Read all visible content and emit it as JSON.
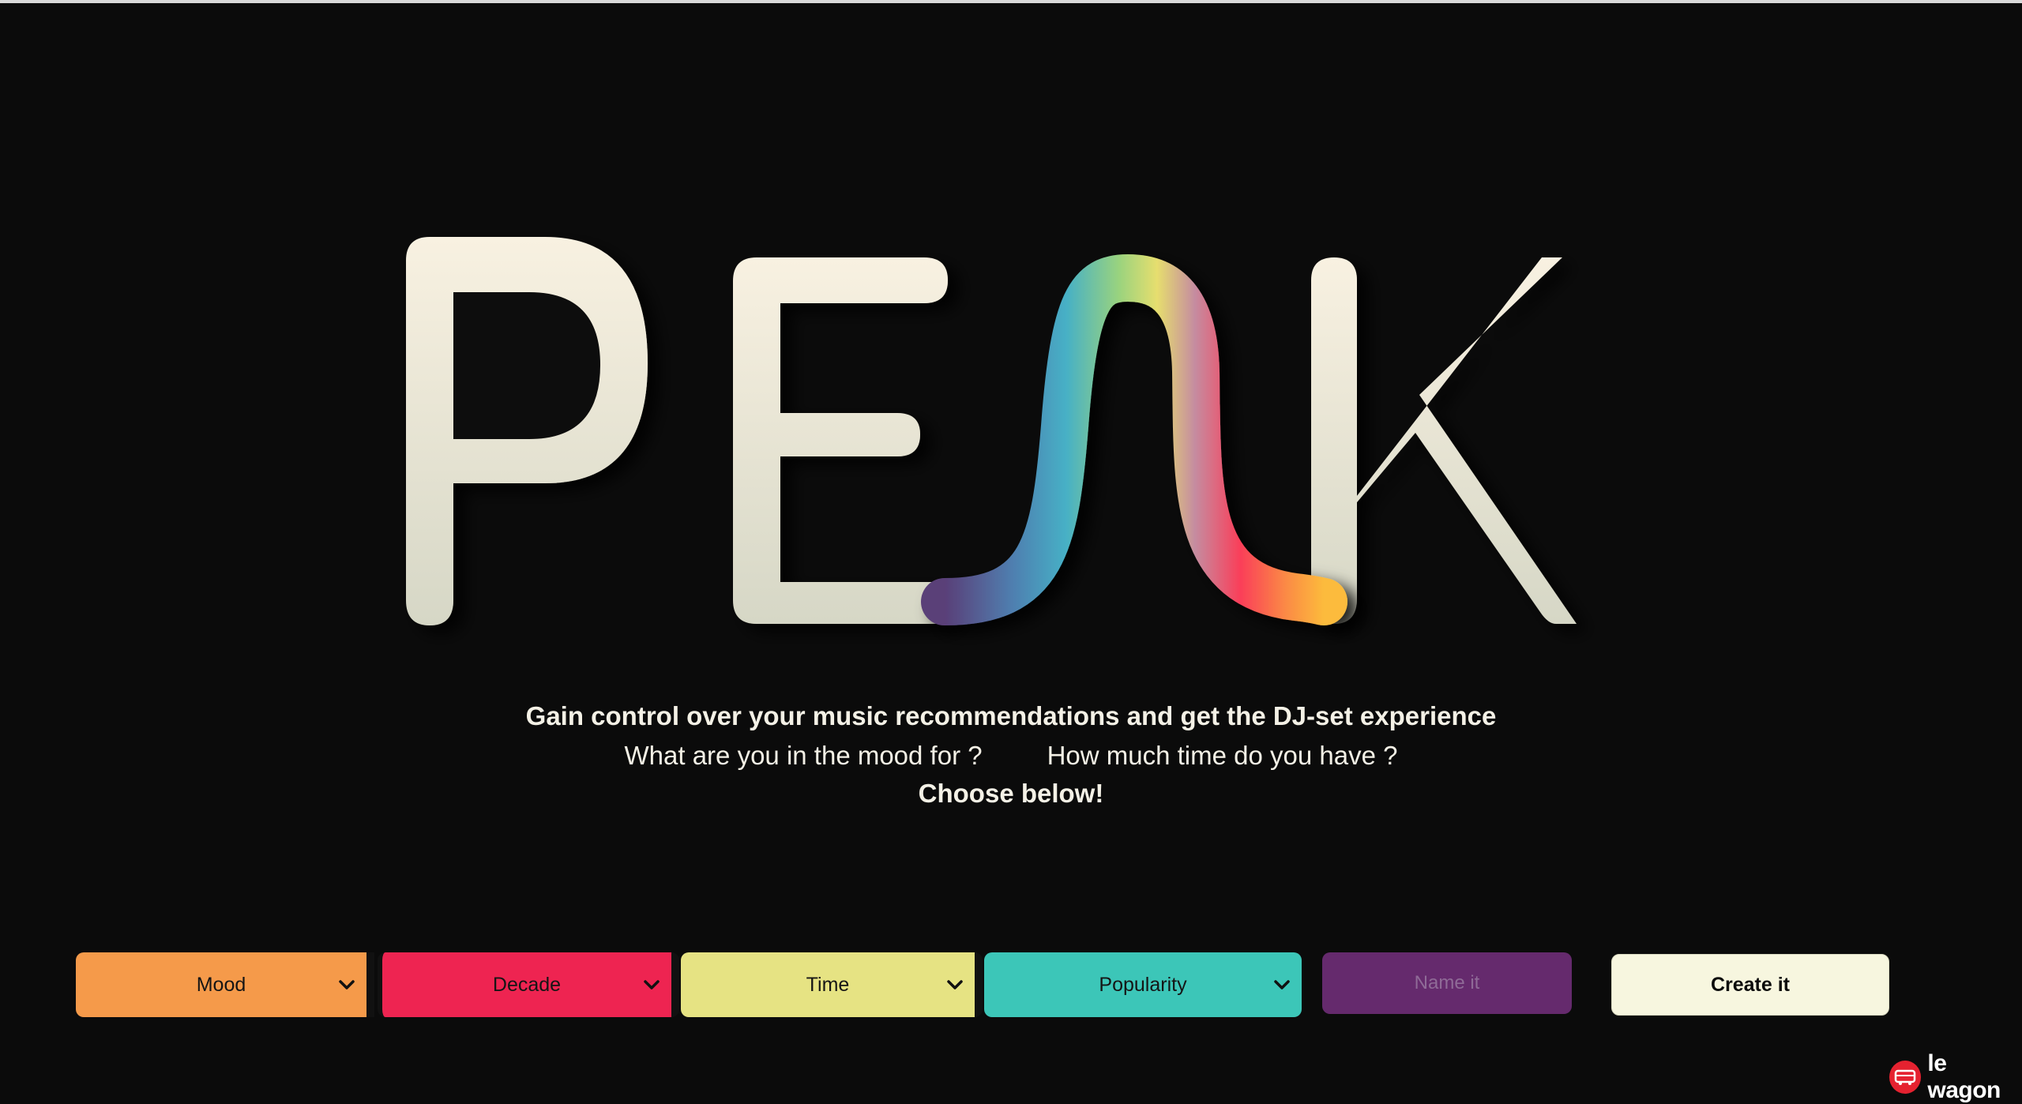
{
  "logo": {
    "text": "PEAK"
  },
  "tagline": {
    "headline": "Gain control over your music recommendations and get the DJ-set experience",
    "question_mood": "What are you in the mood for ?",
    "question_time": "How much time do you have ?",
    "cta": "Choose below!"
  },
  "controls": {
    "mood": {
      "label": "Mood",
      "color": "#f59a4a"
    },
    "decade": {
      "label": "Decade",
      "color": "#ee2451"
    },
    "time": {
      "label": "Time",
      "color": "#e6e383"
    },
    "popularity": {
      "label": "Popularity",
      "color": "#3cc6b8"
    },
    "name": {
      "placeholder": "Name it",
      "color": "#652a6d"
    },
    "create": {
      "label": "Create it",
      "color": "#f7f6df"
    }
  },
  "brand": {
    "name": "le wagon",
    "accent": "#e52230"
  },
  "colors": {
    "background": "#0b0b0b",
    "text": "#f4f1e6"
  }
}
